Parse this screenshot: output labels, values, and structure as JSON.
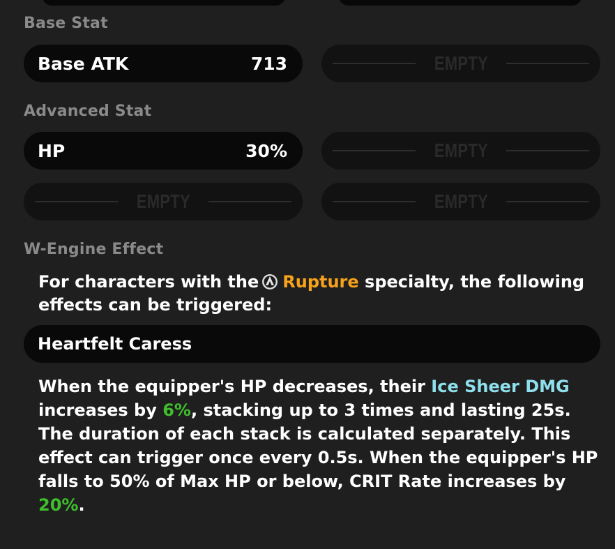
{
  "sections": {
    "base_stat": "Base Stat",
    "advanced_stat": "Advanced Stat",
    "w_engine_effect": "W-Engine Effect"
  },
  "base_stats": [
    {
      "name": "Base ATK",
      "value": "713"
    }
  ],
  "advanced_stats": [
    {
      "name": "HP",
      "value": "30%"
    }
  ],
  "empty_label": "EMPTY",
  "effect": {
    "intro_prefix": "For characters with the",
    "specialty_icon": "rupture-specialty-icon",
    "specialty": "Rupture",
    "intro_suffix": " specialty, the following effects can be triggered:",
    "title": "Heartfelt Caress",
    "desc_1": "When the equipper's HP decreases, their ",
    "desc_highlight": "Ice Sheer DMG",
    "desc_2": " increases by ",
    "desc_value_1": "6%",
    "desc_3": ", stacking up to 3 times and lasting 25s. The duration of each stack is calculated separately. This effect can trigger once every 0.5s. When the equipper's HP falls to 50% of Max HP or below, CRIT Rate increases by ",
    "desc_value_2": "20%",
    "desc_4": "."
  },
  "colors": {
    "background": "#1f1f1f",
    "pill": "#090909",
    "label": "#8a8a8a",
    "specialty": "#f7a21b",
    "ice": "#8ee0ec",
    "value_highlight": "#3fbf2c"
  }
}
